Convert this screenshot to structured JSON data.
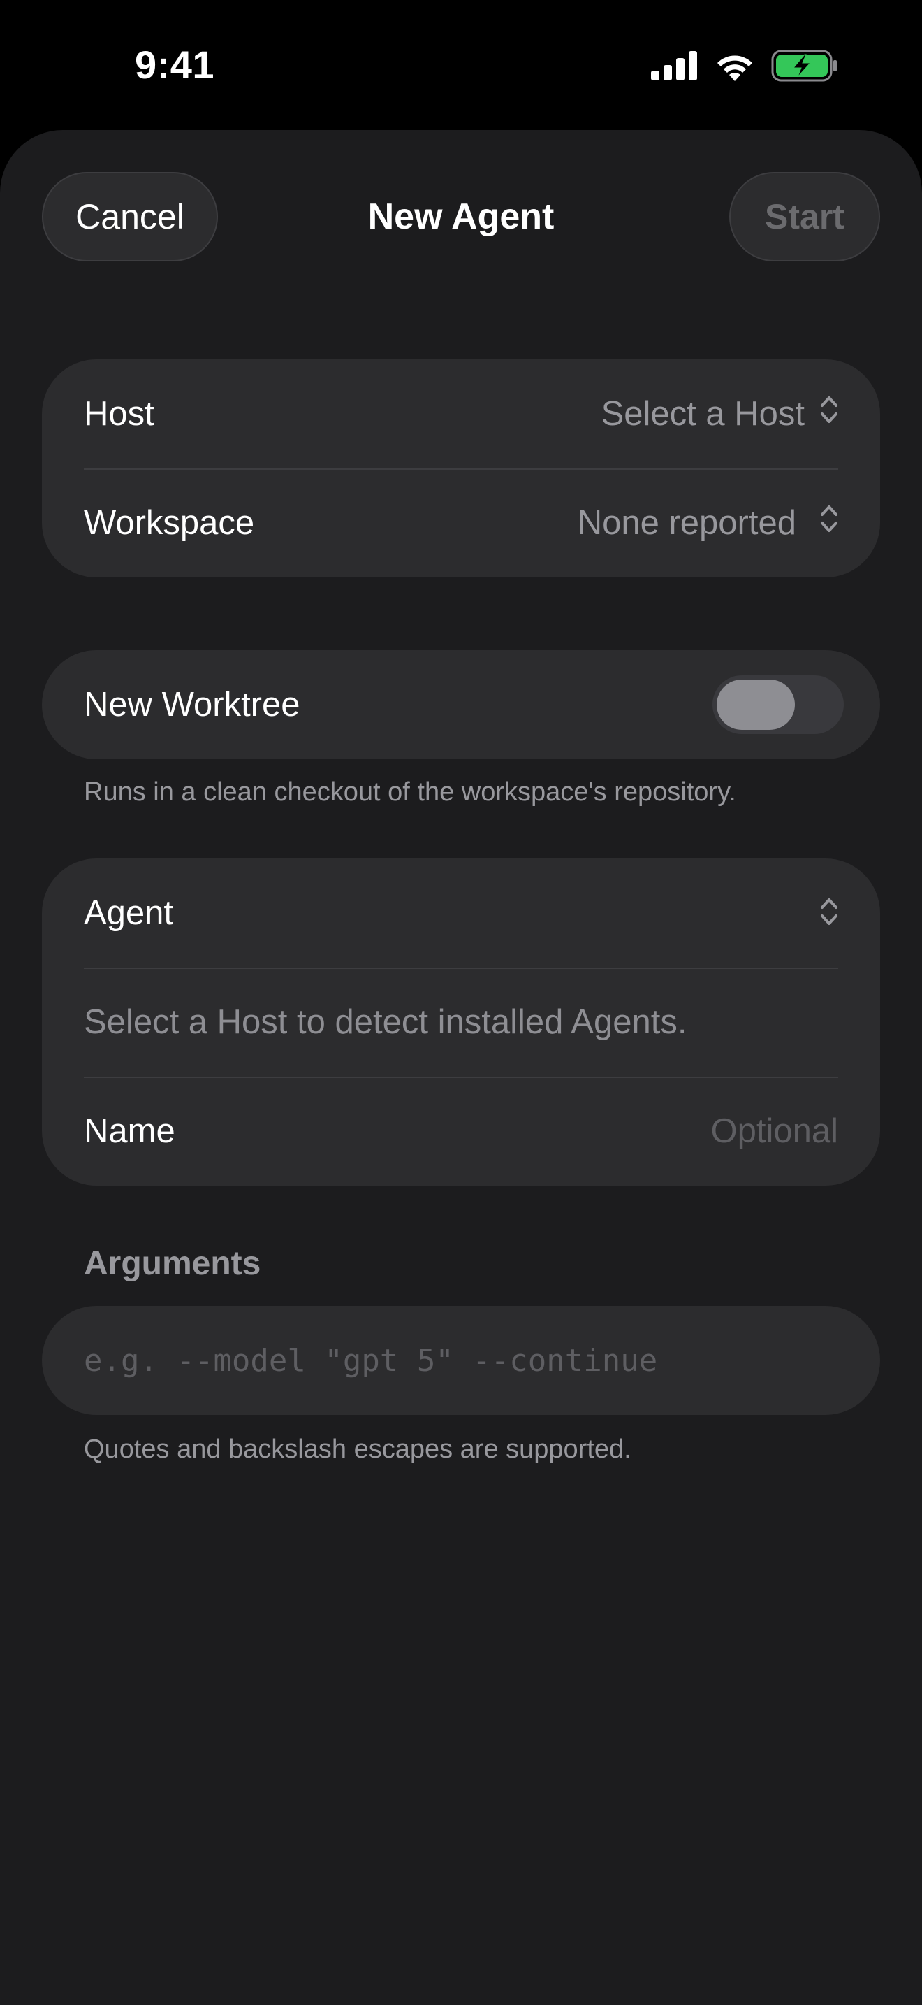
{
  "status_bar": {
    "time": "9:41",
    "icons": [
      "cellular-signal-icon",
      "wifi-icon",
      "battery-charging-icon"
    ],
    "battery_color": "#34c759"
  },
  "nav": {
    "cancel_label": "Cancel",
    "title": "New Agent",
    "start_label": "Start"
  },
  "host_group": {
    "host_label": "Host",
    "host_value": "Select a Host",
    "workspace_label": "Workspace",
    "workspace_value": "None reported",
    "chevron_icon": "chevron-up-down-icon"
  },
  "worktree": {
    "label": "New Worktree",
    "enabled": false,
    "footnote": "Runs in a clean checkout of the workspace's repository."
  },
  "agent_group": {
    "agent_label": "Agent",
    "agent_hint": "Select a Host to detect installed Agents.",
    "name_label": "Name",
    "name_placeholder": "Optional",
    "name_value": ""
  },
  "arguments": {
    "header": "Arguments",
    "placeholder": "e.g. --model \"gpt 5\" --continue",
    "value": "",
    "footnote": "Quotes and backslash escapes are supported."
  },
  "colors": {
    "background": "#1c1c1e",
    "group_background": "#2c2c2e",
    "primary_text": "#ffffff",
    "secondary_text": "#98989d"
  }
}
